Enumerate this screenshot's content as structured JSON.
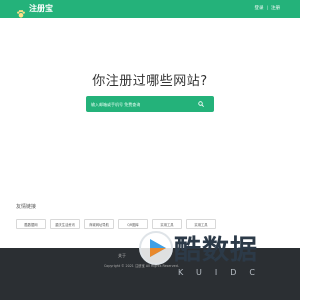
{
  "brand": {
    "name": "注册宝",
    "color": "#24b27a",
    "logo_icon": "paw-icon"
  },
  "nav": {
    "login": "登录",
    "separator": "|",
    "register": "注册"
  },
  "hero": {
    "title": "你注册过哪些网站?"
  },
  "search": {
    "placeholder": "输入邮箱或手机号 免费查询",
    "icon": "search-icon"
  },
  "links": {
    "heading": "友情链接",
    "items": [
      "酷数据网",
      "重庆生活资讯",
      "商城网址导航",
      "QR图库",
      "实用工具",
      "实用工具"
    ]
  },
  "footer": {
    "about": "关于",
    "copyright": "Copyright © 2021 注册宝 All Rights Reserved."
  },
  "watermark": {
    "title": "酷数据",
    "subtitle": "KUIDC"
  }
}
